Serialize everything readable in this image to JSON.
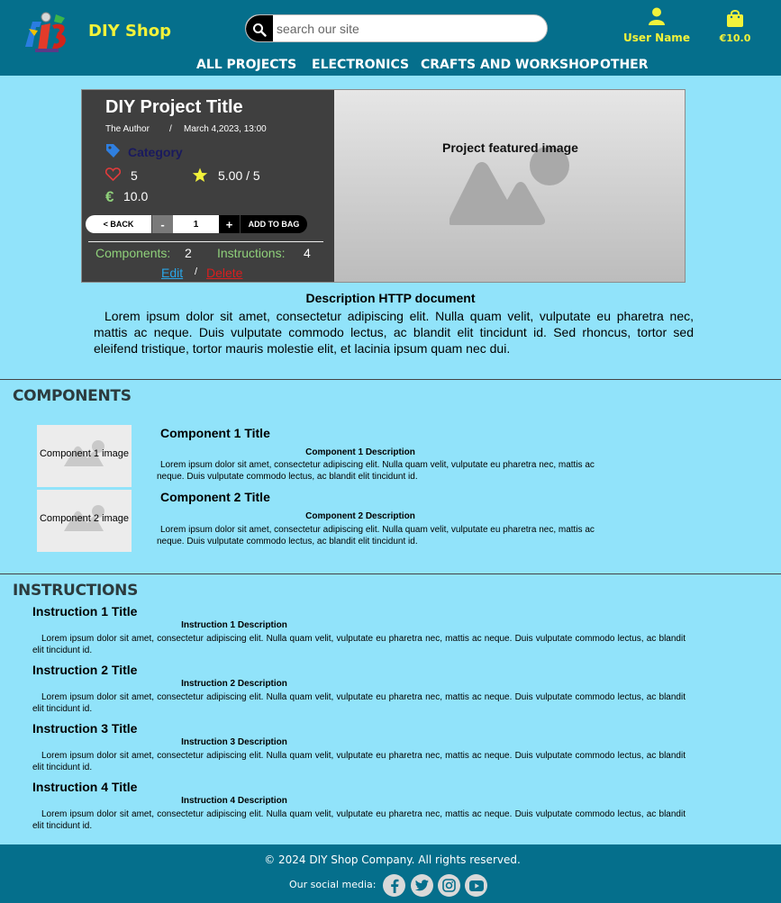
{
  "header": {
    "brand": "DIY Shop",
    "search_placeholder": "search our site",
    "user_label": "User Name",
    "cart_total": "€10.0",
    "nav": [
      "ALL PROJECTS",
      "ELECTRONICS",
      "CRAFTS AND WORKSHOP",
      "OTHER"
    ],
    "colors": {
      "header_bg": "#056f8c",
      "accent": "#f2f23a"
    }
  },
  "project": {
    "title": "DIY Project Title",
    "author": "The Author",
    "separator": "/",
    "date": "March 4,2023, 13:00",
    "category": "Category",
    "likes": "5",
    "rating": "5.00 / 5",
    "currency_symbol": "€",
    "price": "10.0",
    "back_label": "< BACK",
    "minus_label": "-",
    "quantity": "1",
    "plus_label": "+",
    "add_label": "ADD TO BAG",
    "components_label": "Components:",
    "components_count": "2",
    "instructions_label": "Instructions:",
    "instructions_count": "4",
    "edit_label": "Edit",
    "action_separator": "/",
    "delete_label": "Delete",
    "featured_image_label": "Project featured image",
    "icons": [
      "tag-icon",
      "heart-icon",
      "star-icon",
      "euro-icon",
      "image-placeholder-icon"
    ]
  },
  "description": {
    "title": "Description HTTP document",
    "text": "Lorem ipsum dolor sit amet, consectetur adipiscing elit. Nulla quam velit, vulputate eu pharetra nec, mattis ac neque. Duis vulputate commodo lectus, ac blandit elit tincidunt id. Sed rhoncus, tortor sed eleifend tristique, tortor mauris molestie elit, et lacinia ipsum quam nec dui."
  },
  "components": {
    "heading": "COMPONENTS",
    "items": [
      {
        "image_label": "Component 1 image",
        "title": "Component 1 Title",
        "desc_title": "Component 1 Description",
        "desc": "Lorem ipsum dolor sit amet, consectetur adipiscing elit. Nulla quam velit, vulputate eu pharetra nec, mattis ac neque. Duis vulputate commodo lectus, ac blandit elit tincidunt id."
      },
      {
        "image_label": "Component 2 image",
        "title": "Component 2 Title",
        "desc_title": "Component 2 Description",
        "desc": "Lorem ipsum dolor sit amet, consectetur adipiscing elit. Nulla quam velit, vulputate eu pharetra nec, mattis ac neque. Duis vulputate commodo lectus, ac blandit elit tincidunt id."
      }
    ]
  },
  "instructions": {
    "heading": "INSTRUCTIONS",
    "items": [
      {
        "title": "Instruction 1 Title",
        "desc_title": "Instruction 1 Description",
        "desc": "Lorem ipsum dolor sit amet, consectetur adipiscing elit. Nulla quam velit, vulputate eu pharetra nec, mattis ac neque. Duis vulputate commodo lectus, ac blandit elit tincidunt id."
      },
      {
        "title": "Instruction 2 Title",
        "desc_title": "Instruction 2 Description",
        "desc": "Lorem ipsum dolor sit amet, consectetur adipiscing elit. Nulla quam velit, vulputate eu pharetra nec, mattis ac neque. Duis vulputate commodo lectus, ac blandit elit tincidunt id."
      },
      {
        "title": "Instruction 3 Title",
        "desc_title": "Instruction 3 Description",
        "desc": "Lorem ipsum dolor sit amet, consectetur adipiscing elit. Nulla quam velit, vulputate eu pharetra nec, mattis ac neque. Duis vulputate commodo lectus, ac blandit elit tincidunt id."
      },
      {
        "title": "Instruction 4 Title",
        "desc_title": "Instruction 4 Description",
        "desc": "Lorem ipsum dolor sit amet, consectetur adipiscing elit. Nulla quam velit, vulputate eu pharetra nec, mattis ac neque. Duis vulputate commodo lectus, ac blandit elit tincidunt id."
      }
    ]
  },
  "footer": {
    "copyright": "© 2024 DIY Shop Company.  All rights reserved.",
    "social_label": "Our social media:",
    "social_icons": [
      "facebook-icon",
      "twitter-icon",
      "instagram-icon",
      "youtube-icon"
    ]
  }
}
